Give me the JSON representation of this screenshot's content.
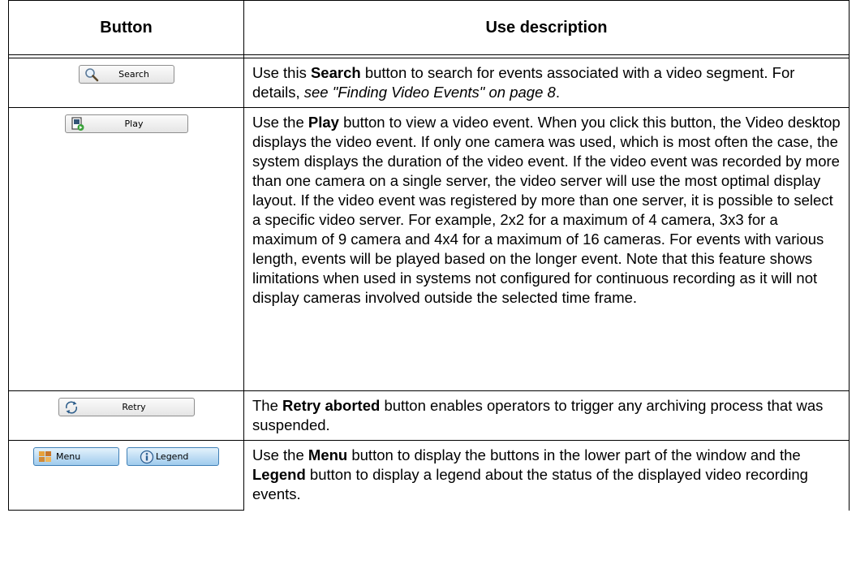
{
  "table": {
    "headers": {
      "button": "Button",
      "description": "Use description"
    },
    "rows": [
      {
        "button_label": "Search",
        "button_icon": "magnifier-icon",
        "desc": {
          "pre": "Use this ",
          "bold": "Search",
          "mid": " button to search for events associated with a video segment. For details, ",
          "italic": "see \"Finding Video Events\" on page 8",
          "post": "."
        }
      },
      {
        "button_label": "Play",
        "button_icon": "play-document-icon",
        "desc": {
          "pre": "Use the ",
          "bold": "Play",
          "post": " button to view a video event. When you click this button, the Video desktop displays the video event. If only one camera was used, which is most often the case, the system displays the duration of the video event. If the video event was recorded by more than one camera on a single server, the video server will use the most optimal display layout. If the video event was registered by more than one server, it is possible to select a specific video server. For example, 2x2 for a maximum of 4 camera, 3x3 for a maximum of 9 camera and 4x4 for a maximum of 16 cameras. For events with various length, events will be played based on the longer event. Note that this feature shows limitations when used in systems not configured for continuous recording as it will not display cameras involved outside the selected time frame."
        }
      },
      {
        "button_label": "Retry",
        "button_icon": "retry-arrows-icon",
        "desc": {
          "pre": "The ",
          "bold": "Retry aborted",
          "post": " button enables operators to trigger any archiving process that was suspended."
        }
      },
      {
        "buttons": [
          {
            "label": "Menu",
            "icon": "menu-puzzle-icon"
          },
          {
            "label": "Legend",
            "icon": "info-legend-icon"
          }
        ],
        "desc": {
          "pre": "Use the ",
          "bold": "Menu",
          "mid": " button to display the buttons in the lower part of the window and the ",
          "bold2": "Legend",
          "post": " button to display a legend about the status of the displayed video recording events."
        }
      }
    ]
  }
}
